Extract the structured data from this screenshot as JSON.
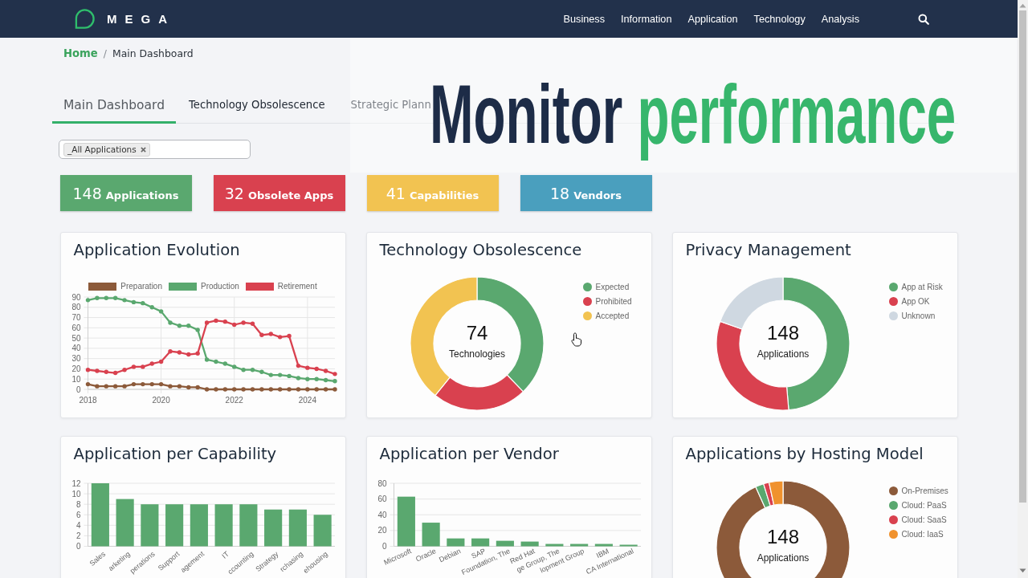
{
  "nav": {
    "brand": "MEGA",
    "links": [
      "Business",
      "Information",
      "Application",
      "Technology",
      "Analysis"
    ]
  },
  "breadcrumb": {
    "items": [
      "Home",
      "Main Dashboard"
    ],
    "separator": "/"
  },
  "tabs": [
    {
      "label": "Main Dashboard",
      "selected": true
    },
    {
      "label": "Technology Obsolescence",
      "selected": false
    },
    {
      "label": "Strategic Plann",
      "selected": false
    }
  ],
  "filter": {
    "tags": [
      "_All Applications"
    ]
  },
  "stats": [
    {
      "value": "148",
      "label": "Applications",
      "color": "#5aa86f"
    },
    {
      "value": "32",
      "label": "Obsolete Apps",
      "color": "#d9414f"
    },
    {
      "value": "41",
      "label": "Capabilities",
      "color": "#f2c351"
    },
    {
      "value": "18",
      "label": "Vendors",
      "color": "#4a9fbe"
    }
  ],
  "cards": [
    {
      "kind": "chart",
      "title": "Application Evolution",
      "chart_data": {
        "type": "line",
        "grid": true,
        "x": [
          2018,
          2018.25,
          2018.5,
          2018.75,
          2019,
          2019.25,
          2019.5,
          2019.75,
          2020,
          2020.25,
          2020.5,
          2020.75,
          2021,
          2021.25,
          2021.5,
          2021.75,
          2022,
          2022.25,
          2022.5,
          2022.75,
          2023,
          2023.25,
          2023.5,
          2023.75,
          2024,
          2024.25,
          2024.5,
          2024.75
        ],
        "xlim": [
          2018,
          2024.75
        ],
        "xticks": [
          2018,
          2020,
          2022,
          2024
        ],
        "ylim": [
          0,
          90
        ],
        "yticks": [
          0,
          10,
          20,
          30,
          40,
          50,
          60,
          70,
          80,
          90
        ],
        "series": [
          {
            "name": "Preparation",
            "color": "#8c5a3a",
            "values": [
              5,
              3,
              3,
              3,
              3,
              5,
              5,
              5,
              5,
              3,
              3,
              2,
              2,
              0,
              0,
              0,
              0,
              0,
              0,
              0,
              0,
              0,
              0,
              0,
              0,
              0,
              0,
              0
            ]
          },
          {
            "name": "Production",
            "color": "#5aa86f",
            "values": [
              87,
              89,
              89,
              89,
              87,
              85,
              84,
              80,
              76,
              65,
              62,
              62,
              58,
              29,
              27,
              25,
              22,
              19,
              19,
              17,
              14,
              14,
              13,
              11,
              10,
              10,
              9,
              8
            ]
          },
          {
            "name": "Retirement",
            "color": "#d9414f",
            "values": [
              19,
              18,
              17,
              16,
              19,
              22,
              22,
              25,
              27,
              37,
              36,
              34,
              35,
              65,
              67,
              66,
              63,
              65,
              64,
              53,
              54,
              51,
              52,
              23,
              21,
              20,
              18,
              15
            ]
          }
        ]
      }
    },
    {
      "kind": "donut",
      "title": "Technology Obsolescence",
      "center_value": "74",
      "center_label": "Technologies",
      "legend": [
        {
          "label": "Expected",
          "color": "#5aa86f"
        },
        {
          "label": "Prohibited",
          "color": "#d9414f"
        },
        {
          "label": "Accepted",
          "color": "#f2c351"
        }
      ]
    },
    {
      "kind": "donut",
      "title": "Privacy Management",
      "center_value": "148",
      "center_label": "Applications",
      "legend": [
        {
          "label": "App at Risk",
          "color": "#5aa86f"
        },
        {
          "label": "App OK",
          "color": "#d9414f"
        },
        {
          "label": "Unknown",
          "color": "#cfd8e1"
        }
      ]
    },
    {
      "kind": "chart",
      "title": "Application per Capability",
      "chart_data": {
        "type": "bar",
        "grid": true,
        "categories": [
          "Sales",
          "arketing",
          "perations",
          "Support",
          "agement",
          "IT",
          "ccounting",
          "Strategy",
          "rchasing",
          "ehousing"
        ],
        "values": [
          12,
          9,
          8,
          8,
          8,
          8,
          8,
          7,
          7,
          6
        ],
        "ylim": [
          0,
          12
        ],
        "yticks": [
          0,
          2,
          4,
          6,
          8,
          10,
          12
        ]
      }
    },
    {
      "kind": "chart",
      "title": "Application per Vendor",
      "chart_data": {
        "type": "bar",
        "grid": true,
        "categories": [
          "Microsoft",
          "Oracle",
          "Debian",
          "SAP",
          "Foundation, The",
          "Red Hat",
          "ge Group, The",
          "lopment Group",
          "IBM",
          "CA International"
        ],
        "values": [
          63,
          30,
          10,
          10,
          7,
          6,
          3,
          3,
          3,
          2
        ],
        "ylim": [
          0,
          80
        ],
        "yticks": [
          0,
          20,
          40,
          60,
          80
        ]
      }
    },
    {
      "kind": "donut",
      "title": "Applications by Hosting Model",
      "center_value": "148",
      "center_label": "Applications",
      "legend": [
        {
          "label": "On-Premises",
          "color": "#8c5a3a"
        },
        {
          "label": "Cloud: PaaS",
          "color": "#5aa86f"
        },
        {
          "label": "Cloud: SaaS",
          "color": "#d9414f"
        },
        {
          "label": "Cloud: IaaS",
          "color": "#f0922e"
        }
      ]
    }
  ],
  "overlay": {
    "title": "Monitor",
    "accent": "performance"
  }
}
